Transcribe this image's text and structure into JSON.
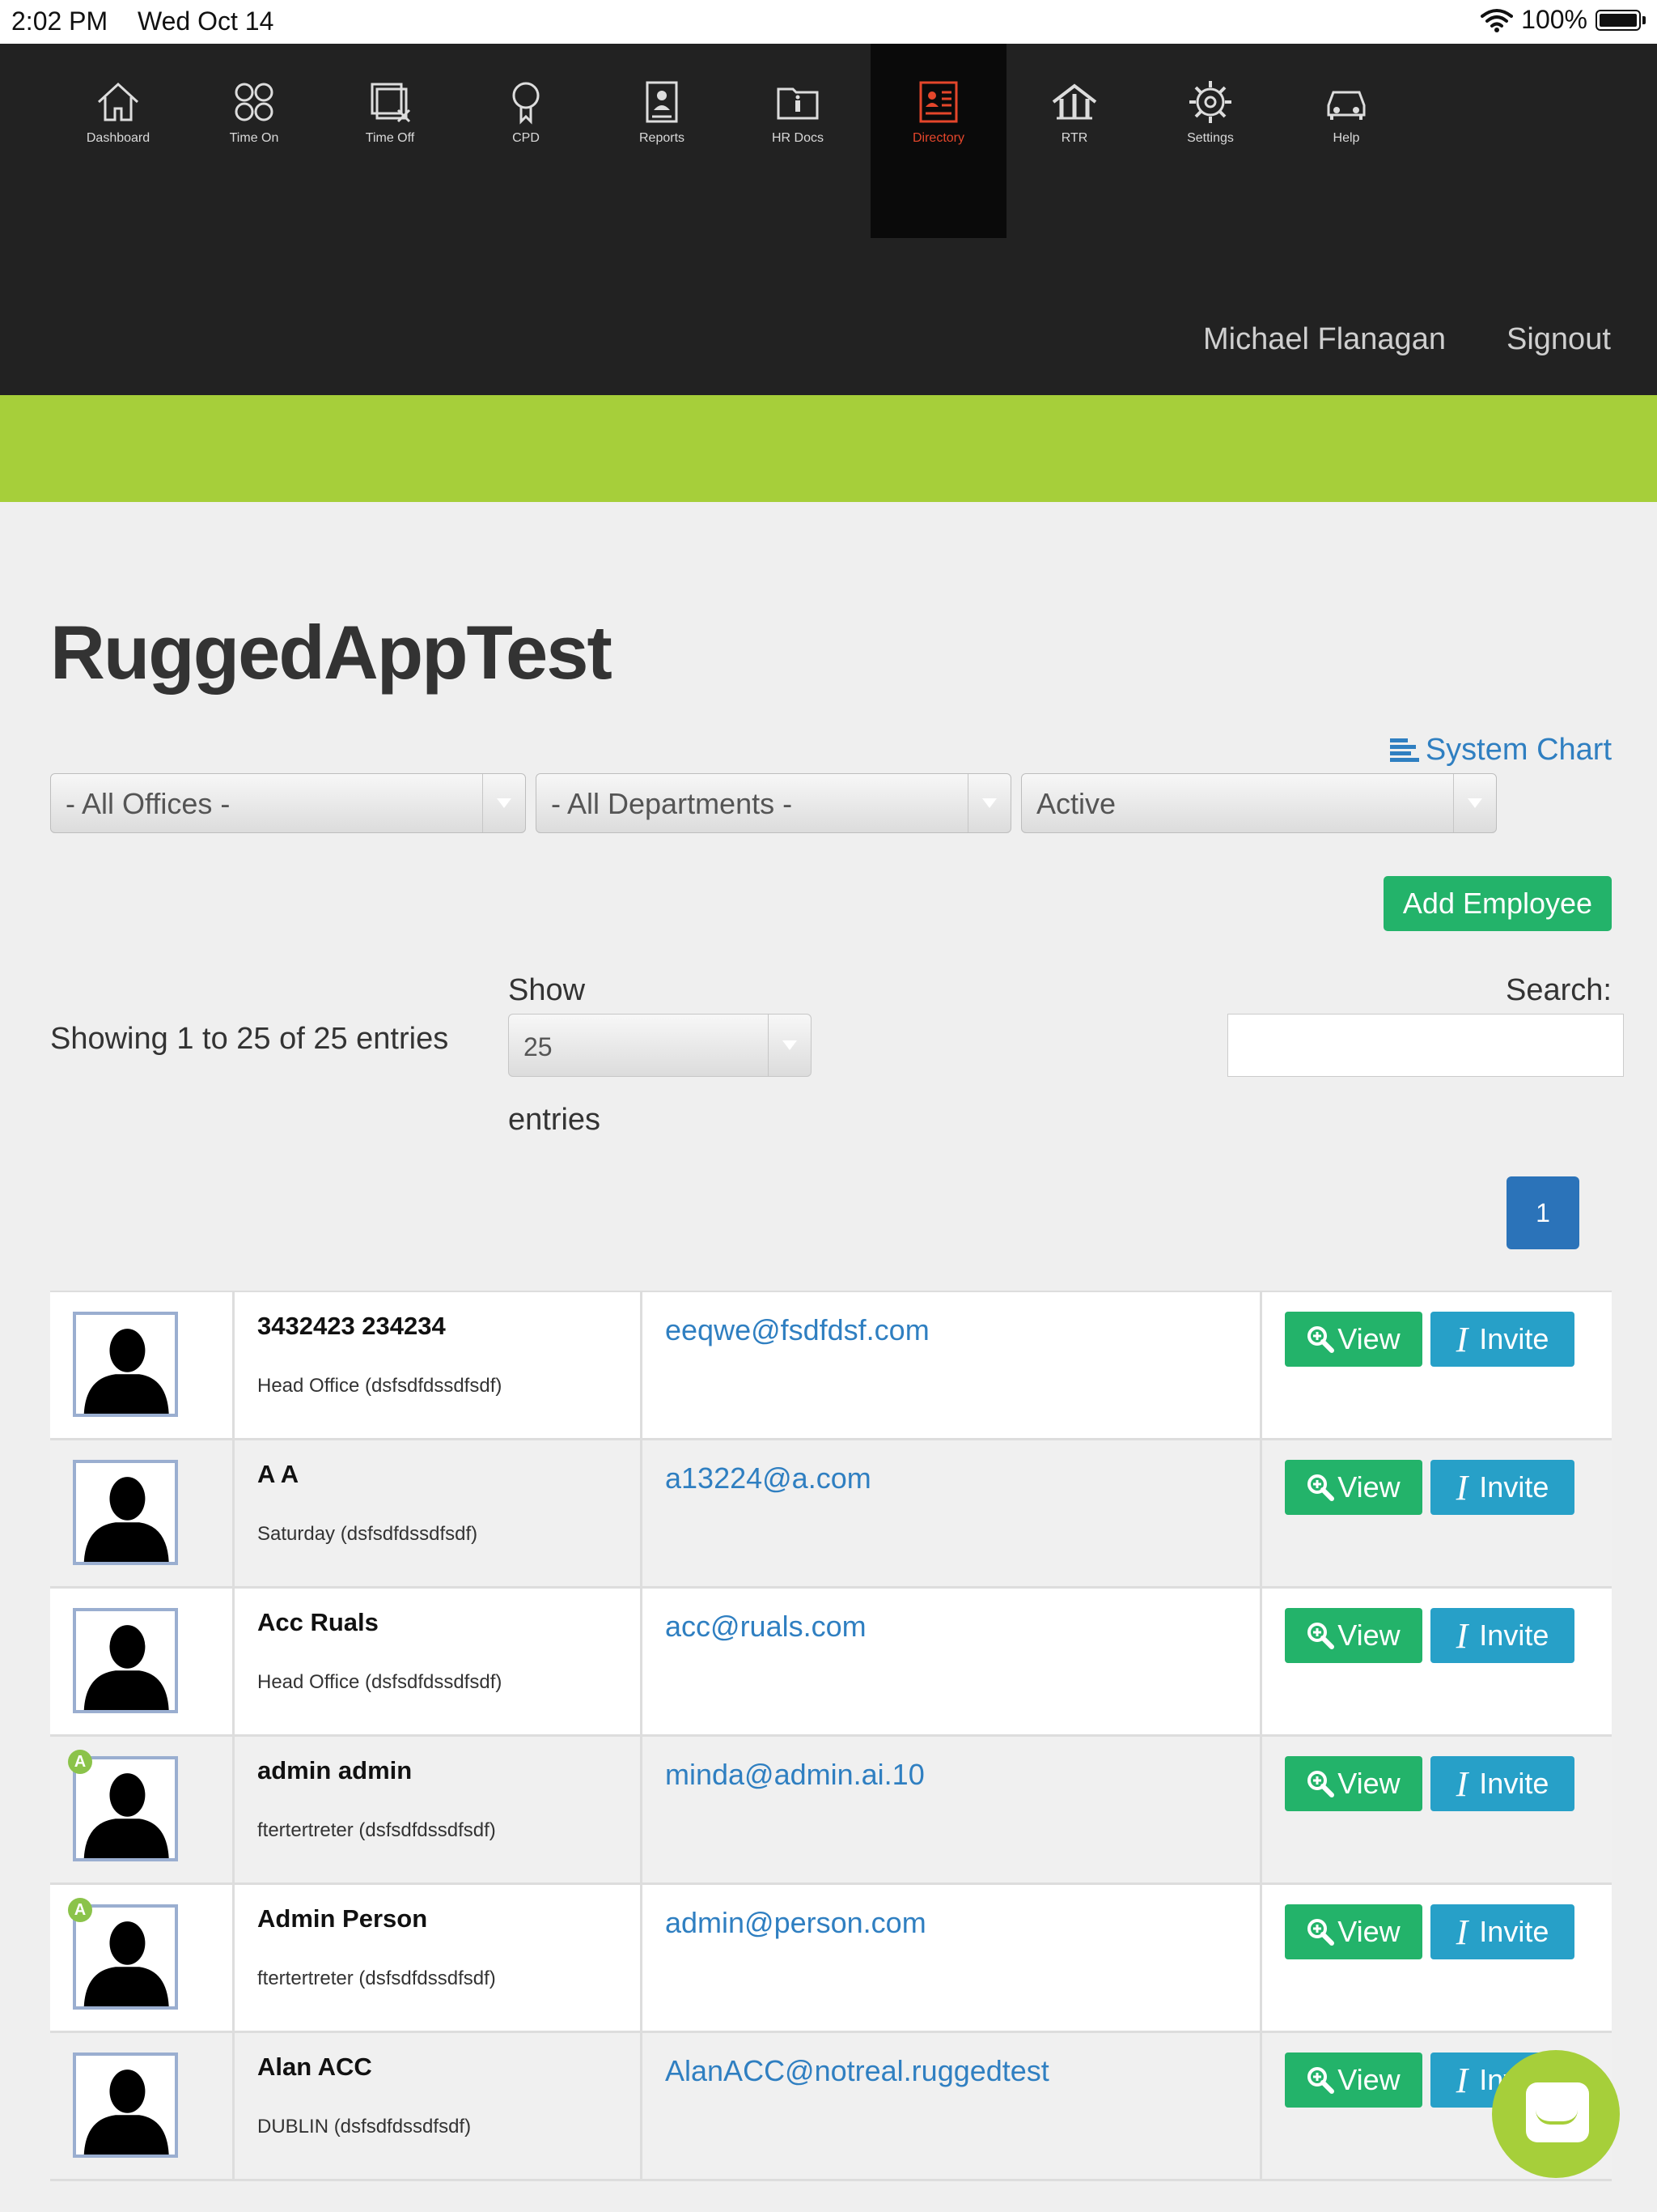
{
  "status_bar": {
    "time": "2:02 PM",
    "date": "Wed Oct 14",
    "battery": "100%"
  },
  "nav": {
    "items": [
      {
        "label": "Dashboard",
        "icon": "home-icon"
      },
      {
        "label": "Time On",
        "icon": "time-on-icon"
      },
      {
        "label": "Time Off",
        "icon": "time-off-icon"
      },
      {
        "label": "CPD",
        "icon": "cpd-icon"
      },
      {
        "label": "Reports",
        "icon": "reports-icon"
      },
      {
        "label": "HR Docs",
        "icon": "hr-docs-icon"
      },
      {
        "label": "Directory",
        "icon": "directory-icon",
        "active": true
      },
      {
        "label": "RTR",
        "icon": "rtr-icon"
      },
      {
        "label": "Settings",
        "icon": "gear-icon"
      },
      {
        "label": "Help",
        "icon": "help-car-icon"
      }
    ],
    "active_color": "#e5462b",
    "user_name": "Michael Flanagan",
    "signout": "Signout"
  },
  "brand_color": "#a6cf3a",
  "page": {
    "title": "RuggedAppTest",
    "system_chart": "System Chart",
    "filters": {
      "offices": "- All Offices -",
      "departments": "- All Departments -",
      "status": "Active"
    },
    "add_employee": "Add Employee",
    "showing": "Showing 1 to 25 of 25 entries",
    "show_label": "Show",
    "page_length": "25",
    "entries_label": "entries",
    "search_label": "Search:",
    "search_value": "",
    "pagination": {
      "current": "1"
    }
  },
  "employees": [
    {
      "name": "3432423 234234",
      "office": "Head Office (dsfsdfdssdfsdf)",
      "email": "eeqwe@fsdfdsf.com",
      "admin": false
    },
    {
      "name": "A A",
      "office": "Saturday (dsfsdfdssdfsdf)",
      "email": "a13224@a.com",
      "admin": false
    },
    {
      "name": "Acc Ruals",
      "office": "Head Office (dsfsdfdssdfsdf)",
      "email": "acc@ruals.com",
      "admin": false
    },
    {
      "name": "admin admin",
      "office": "ftertertreter (dsfsdfdssdfsdf)",
      "email": "minda@admin.ai.10",
      "admin": true
    },
    {
      "name": "Admin Person",
      "office": "ftertertreter (dsfsdfdssdfsdf)",
      "email": "admin@person.com",
      "admin": true
    },
    {
      "name": "Alan ACC",
      "office": "DUBLIN (dsfsdfdssdfsdf)",
      "email": "AlanACC@notreal.ruggedtest",
      "admin": false
    }
  ],
  "row_actions": {
    "view": "View",
    "invite": "Invite",
    "admin_badge": "A"
  },
  "colors": {
    "view_button": "#23b36a",
    "invite_button": "#27a0c8",
    "link": "#2f7fc1",
    "pagination": "#2b73b9"
  }
}
